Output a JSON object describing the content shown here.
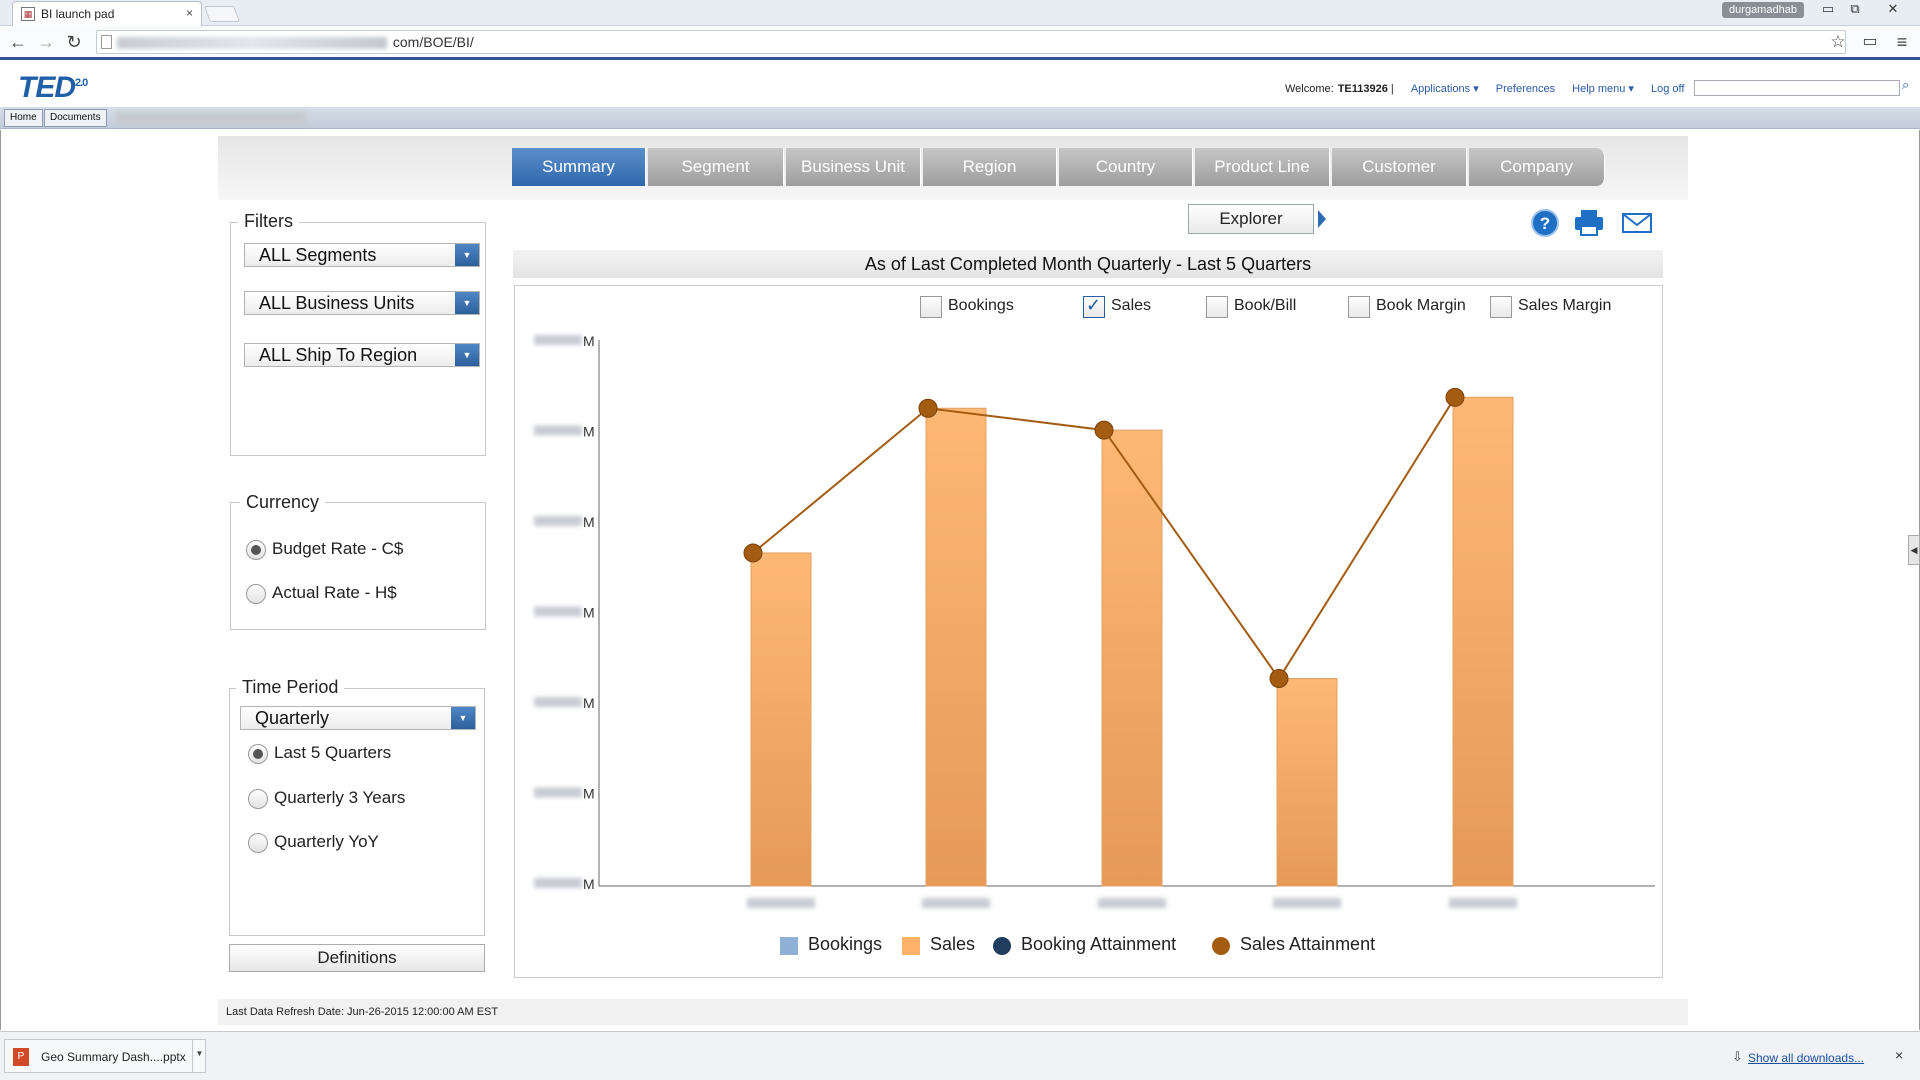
{
  "browser": {
    "tab_title": "BI launch pad",
    "tab_close": "×",
    "profile": "durgamadhab",
    "url_visible": "com/BOE/BI/",
    "win_minimize": "▭",
    "win_restore": "⧉",
    "win_close": "✕"
  },
  "app": {
    "logo_text": "TED",
    "logo_version": "2.0",
    "welcome_label": "Welcome:",
    "user_id": "TE113926",
    "user_separator": "|",
    "menu_applications": "Applications ▾",
    "menu_preferences": "Preferences",
    "menu_help": "Help menu ▾",
    "menu_logoff": "Log off",
    "nav_home": "Home",
    "nav_documents": "Documents"
  },
  "tabs": [
    {
      "label": "Summary",
      "active": true
    },
    {
      "label": "Segment",
      "active": false
    },
    {
      "label": "Business Unit",
      "active": false
    },
    {
      "label": "Region",
      "active": false
    },
    {
      "label": "Country",
      "active": false
    },
    {
      "label": "Product Line",
      "active": false
    },
    {
      "label": "Customer",
      "active": false
    },
    {
      "label": "Company",
      "active": false
    }
  ],
  "filters": {
    "title": "Filters",
    "segments": "ALL Segments",
    "business_units": "ALL Business Units",
    "ship_to_region": "ALL Ship To Region"
  },
  "currency": {
    "title": "Currency",
    "options": [
      {
        "label": "Budget Rate - C$",
        "selected": true
      },
      {
        "label": "Actual Rate - H$",
        "selected": false
      }
    ]
  },
  "time_period": {
    "title": "Time Period",
    "selected": "Quarterly",
    "options": [
      {
        "label": "Last 5 Quarters",
        "selected": true
      },
      {
        "label": "Quarterly 3 Years",
        "selected": false
      },
      {
        "label": "Quarterly YoY",
        "selected": false
      }
    ]
  },
  "definitions_button": "Definitions",
  "explorer_button": "Explorer",
  "chart_title": "As of Last Completed Month Quarterly  - Last 5 Quarters",
  "checkboxes": [
    {
      "label": "Bookings",
      "checked": false
    },
    {
      "label": "Sales",
      "checked": true
    },
    {
      "label": "Book/Bill",
      "checked": false
    },
    {
      "label": "Book Margin",
      "checked": false
    },
    {
      "label": "Sales Margin",
      "checked": false
    }
  ],
  "legend": [
    {
      "label": "Bookings",
      "color": "#8fb1d6",
      "shape": "square"
    },
    {
      "label": "Sales",
      "color": "#ffb36a",
      "shape": "square"
    },
    {
      "label": "Booking Attainment",
      "color": "#1f3d5c",
      "shape": "circle"
    },
    {
      "label": "Sales Attainment",
      "color": "#a45b12",
      "shape": "circle"
    }
  ],
  "chart_data": {
    "type": "bar",
    "y_unit_suffix": "M",
    "categories_blurred": true,
    "ylim": [
      0,
      100
    ],
    "series": [
      {
        "name": "Sales",
        "color": "#ffb36a",
        "values": [
          61,
          87.5,
          83.5,
          38,
          89.5
        ]
      },
      {
        "name": "Sales Attainment",
        "type": "line",
        "color": "#a45b12",
        "values": [
          61,
          87.5,
          83.5,
          38,
          89.5
        ]
      }
    ]
  },
  "footer": {
    "last_refresh": "Last Data Refresh Date: Jun-26-2015 12:00:00 AM EST"
  },
  "downloads": {
    "file_name": "Geo Summary Dash....pptx",
    "show_all": "Show all downloads...",
    "close": "×"
  }
}
